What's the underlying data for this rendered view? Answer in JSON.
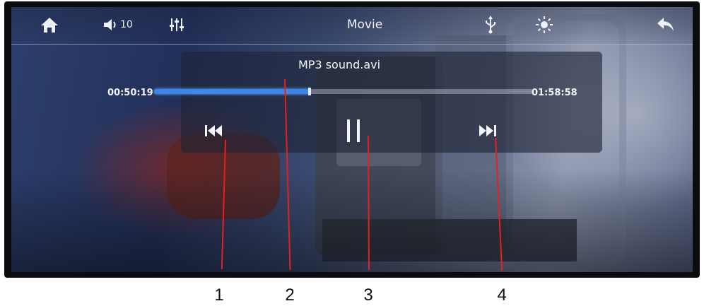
{
  "topbar": {
    "home_icon": "home-icon",
    "volume_icon": "speaker-icon",
    "volume_level": "10",
    "eq_icon": "equalizer-icon",
    "title": "Movie",
    "usb_icon": "usb-icon",
    "brightness_icon": "brightness-icon",
    "back_icon": "back-arrow-icon"
  },
  "player": {
    "filename": "MP3 sound.avi",
    "current_time": "00:50:19",
    "total_time": "01:58:58",
    "progress_fraction": 0.41,
    "progress_color": "#3f86e8",
    "prev_icon": "previous-track-icon",
    "play_pause_icon": "pause-icon",
    "next_icon": "next-track-icon"
  },
  "callouts": [
    {
      "number": "1"
    },
    {
      "number": "2"
    },
    {
      "number": "3"
    },
    {
      "number": "4"
    }
  ],
  "colors": {
    "callout_line": "#e62020",
    "panel_bg": "rgba(30,36,54,0.62)"
  }
}
